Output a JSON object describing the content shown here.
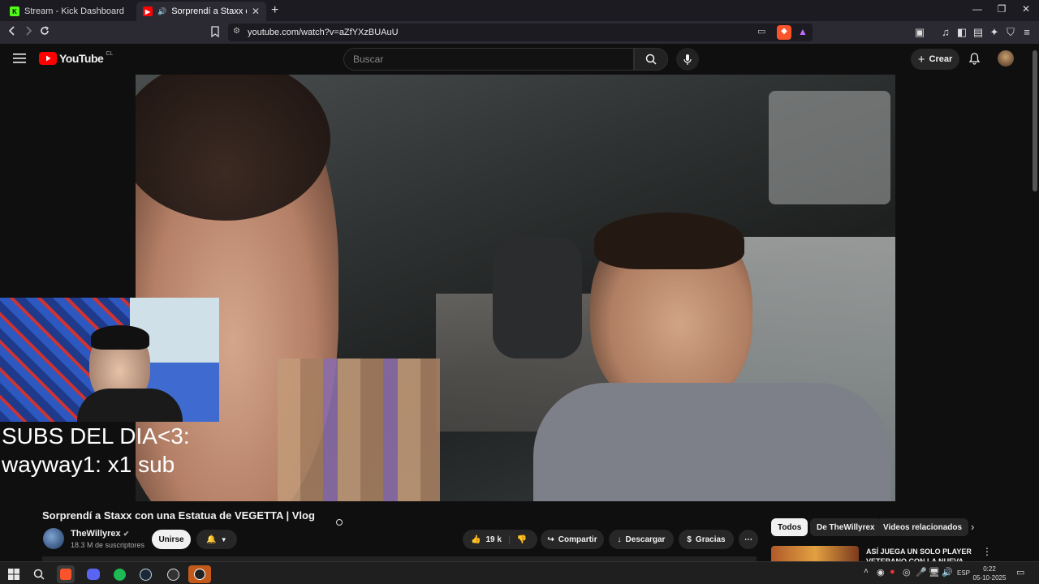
{
  "browser": {
    "tabs": [
      {
        "label": "Stream - Kick Dashboard"
      },
      {
        "label": "Sorprendí a Staxx con una Est"
      }
    ],
    "url": "youtube.com/watch?v=aZfYXzBUAuU",
    "new_tab_icon": "plus-icon"
  },
  "youtube": {
    "logo_text": "YouTube",
    "region": "CL",
    "search_placeholder": "Buscar",
    "create_label": "Crear"
  },
  "overlay": {
    "line1": "SUBS DEL DIA<3:",
    "line2": "wayway1: x1 sub"
  },
  "video": {
    "title": "Sorprendí a Staxx con una Estatua de VEGETTA | Vlog",
    "channel": "TheWillyrex",
    "subscribers": "18.3 M de suscriptores",
    "join_label": "Unirse",
    "likes": "19 k",
    "share_label": "Compartir",
    "download_label": "Descargar",
    "thanks_label": "Gracias"
  },
  "chips": [
    "Todos",
    "De TheWillyrex",
    "Videos relacionados"
  ],
  "related": {
    "title_line1": "ASÍ JUEGA UN SOLO PLAYER",
    "title_line2": "VETERANO CON LA NUEVA"
  },
  "taskbar": {
    "lang": "ESP",
    "time": "0:22",
    "date": "05-10-2025"
  },
  "colors": {
    "youtube_red": "#ff0000",
    "kick_green": "#53fc18",
    "background": "#0f0f0f"
  }
}
